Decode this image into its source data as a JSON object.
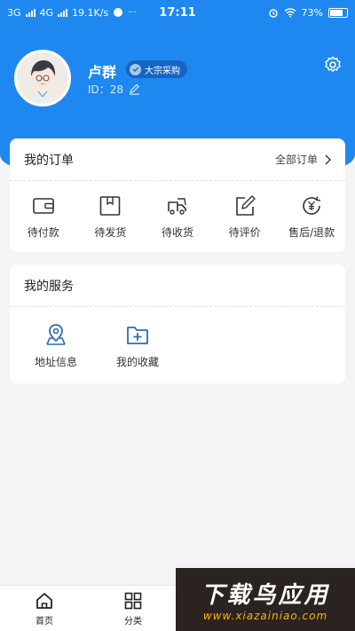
{
  "status_bar": {
    "network_1": "3G",
    "network_2": "4G",
    "speed": "19.1K/s",
    "time": "17:11",
    "battery": "73%"
  },
  "profile": {
    "username": "卢群",
    "badge": "大宗采购",
    "id_text": "ID：28"
  },
  "orders": {
    "title": "我的订单",
    "all_label": "全部订单",
    "items": [
      {
        "label": "待付款",
        "icon": "wallet-icon"
      },
      {
        "label": "待发货",
        "icon": "package-icon"
      },
      {
        "label": "待收货",
        "icon": "truck-icon"
      },
      {
        "label": "待评价",
        "icon": "edit-icon"
      },
      {
        "label": "售后/退款",
        "icon": "refund-icon"
      }
    ]
  },
  "services": {
    "title": "我的服务",
    "items": [
      {
        "label": "地址信息",
        "icon": "location-icon"
      },
      {
        "label": "我的收藏",
        "icon": "folder-add-icon"
      }
    ]
  },
  "tabbar": {
    "items": [
      {
        "label": "首页",
        "icon": "home-icon"
      },
      {
        "label": "分类",
        "icon": "grid-icon"
      }
    ]
  },
  "watermark": {
    "title": "下载鸟应用",
    "url": "www.xiazainiao.com"
  },
  "colors": {
    "primary": "#1e88f0",
    "page_bg": "#f4f4f6",
    "icon_blue": "#2f6bb5"
  }
}
